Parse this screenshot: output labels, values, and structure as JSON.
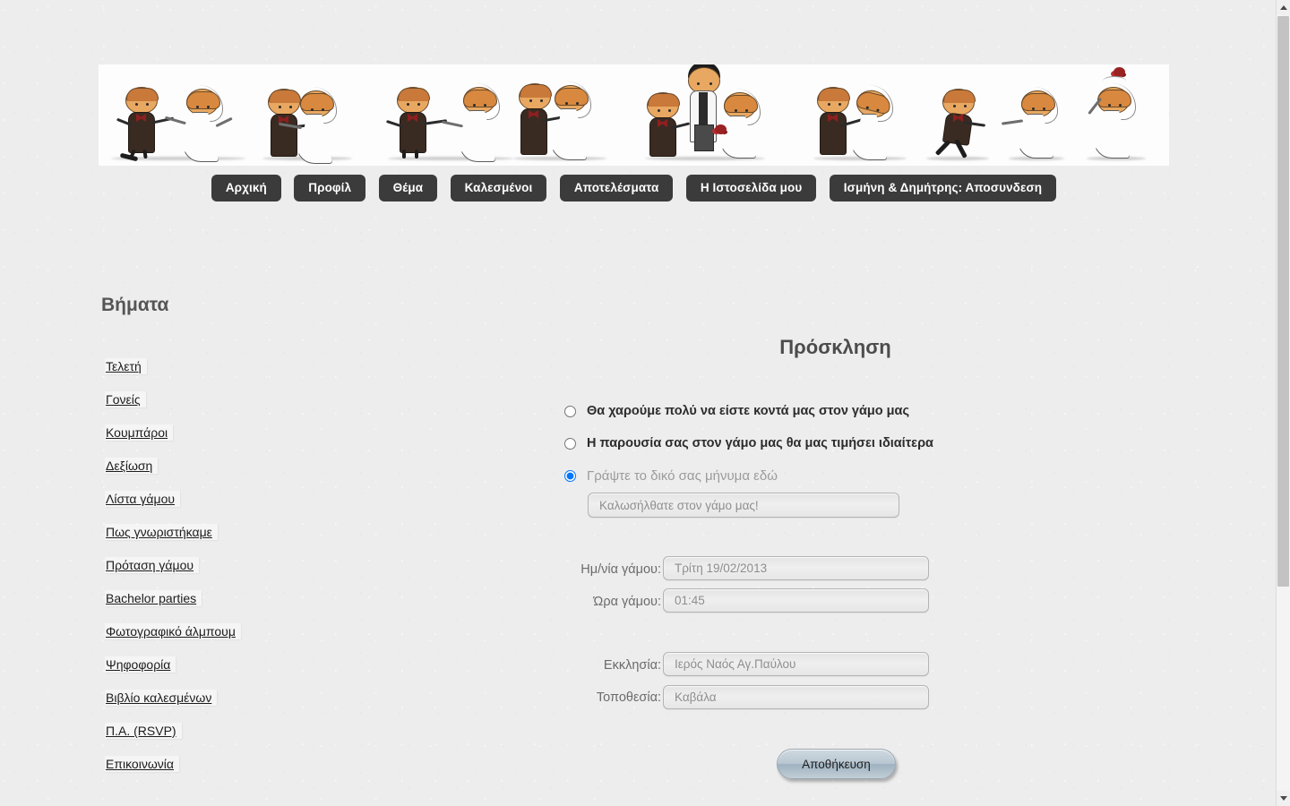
{
  "page": {
    "title": "Πρόσκληση",
    "lang": "el"
  },
  "nav": {
    "items": [
      {
        "label": "Αρχική",
        "name": "nav-home"
      },
      {
        "label": "Προφίλ",
        "name": "nav-profile"
      },
      {
        "label": "Θέμα",
        "name": "nav-theme"
      },
      {
        "label": "Καλεσμένοι",
        "name": "nav-guests"
      },
      {
        "label": "Αποτελέσματα",
        "name": "nav-results"
      },
      {
        "label": "Η Ιστοσελίδα μου",
        "name": "nav-my-site"
      },
      {
        "label": "Ισμήνη & Δημήτρης: Αποσυνδεση",
        "name": "nav-logout"
      }
    ]
  },
  "sidebar": {
    "heading": "Βήματα",
    "items": [
      {
        "label": "Τελετή"
      },
      {
        "label": "Γονείς"
      },
      {
        "label": "Κουμπάροι"
      },
      {
        "label": "Δεξίωση"
      },
      {
        "label": "Λίστα γάμου"
      },
      {
        "label": "Πως γνωριστήκαμε"
      },
      {
        "label": "Πρόταση γάμου"
      },
      {
        "label": "Bachelor parties"
      },
      {
        "label": "Φωτογραφικό άλμπουμ"
      },
      {
        "label": "Ψηφοφορία"
      },
      {
        "label": "Βιβλίο καλεσμένων"
      },
      {
        "label": "Π.Α. (RSVP)"
      },
      {
        "label": "Επικοινωνία"
      }
    ]
  },
  "form": {
    "title": "Πρόσκληση",
    "radio_options": [
      {
        "label": "Θα χαρούμε πολύ να είστε κοντά μας στον γάμο μας",
        "selected": false,
        "style": "bold"
      },
      {
        "label": "Η παρουσία σας στον γάμο μας θα μας τιμήσει ιδιαίτερα",
        "selected": false,
        "style": "bold"
      },
      {
        "label": "Γράψτε το δικό σας μήνυμα εδώ",
        "selected": true,
        "style": "muted"
      }
    ],
    "custom_message": {
      "value": "",
      "placeholder": "Καλωσήλθατε στον γάμο μας!"
    },
    "fields": [
      {
        "label": "Ημ/νία γάμου:",
        "value": "",
        "placeholder": "Τρίτη 19/02/2013",
        "name": "wedding-date"
      },
      {
        "label": "Ώρα γάμου:",
        "value": "",
        "placeholder": "01:45",
        "name": "wedding-time"
      },
      {
        "label": "Εκκλησία:",
        "value": "",
        "placeholder": "Ιερός Ναός Αγ.Παύλου",
        "name": "church"
      },
      {
        "label": "Τοποθεσία:",
        "value": "",
        "placeholder": "Καβάλα",
        "name": "location"
      }
    ],
    "save_label": "Αποθήκευση"
  },
  "banner": {
    "alt": "wedding-couple-cartoon-banner"
  },
  "colors": {
    "page_background": "#ededed",
    "nav_button": "#3b3b3b",
    "nav_button_text": "#ffffff",
    "heading_text": "#4c4c4c",
    "link_text": "#1c1c1c",
    "input_text": "#7d7d7d",
    "save_button": "#b9c7d2"
  },
  "scrollbar": {
    "up_icon": "chevron-up-icon",
    "down_icon": "chevron-down-icon"
  }
}
